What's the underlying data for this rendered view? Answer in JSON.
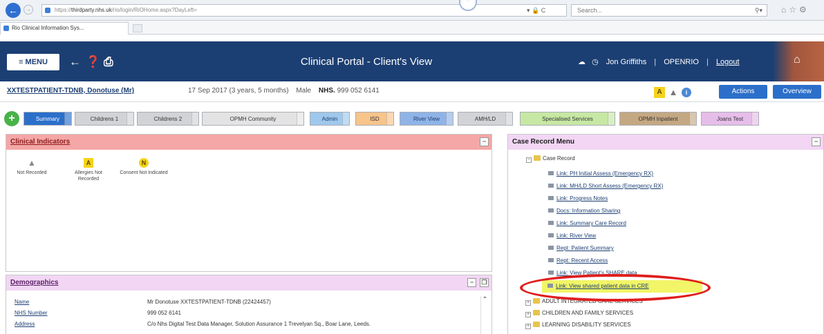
{
  "browser": {
    "url_prefix": "https://",
    "url_domain": "thirdparty.nhs.uk",
    "url_rest": "/rio/login/RiOHome.aspx?DayLeft=",
    "address_tools": "▾ 🔒 C",
    "search_placeholder": "Search...",
    "tab_title": "Rio Clinical Information Sys..."
  },
  "header": {
    "menu_label": "≡ MENU",
    "title": "Clinical Portal - Client's View",
    "user": "Jon Griffiths",
    "role": "OPENRIO",
    "logout": "Logout"
  },
  "patient": {
    "name": "XXTESTPATIENT-TDNB, Donotuse (Mr)",
    "dob_age": "17 Sep 2017 (3 years, 5 months)",
    "sex": "Male",
    "nhs_label": "NHS.",
    "nhs_number": "999 052 6141",
    "actions_label": "Actions",
    "overview_label": "Overview"
  },
  "tabs": [
    {
      "label": "Summary",
      "color": "#2b6fca",
      "text": "#ffffff"
    },
    {
      "label": "Childrens 1",
      "color": "#d2d3d6",
      "text": "#333333"
    },
    {
      "label": "Childrens 2",
      "color": "#d2d3d6",
      "text": "#333333"
    },
    {
      "label": "OPMH Community",
      "color": "#e3e3e3",
      "text": "#333333"
    },
    {
      "label": "Admin",
      "color": "#9fc8ec",
      "text": "#1c3f73"
    },
    {
      "label": "ISD",
      "color": "#f7c48a",
      "text": "#333333"
    },
    {
      "label": "River View",
      "color": "#8fb3e6",
      "text": "#1c3f73"
    },
    {
      "label": "AMH/LD",
      "color": "#d2d3d6",
      "text": "#333333"
    },
    {
      "label": "Specialised Services",
      "color": "#c7e8a4",
      "text": "#333333"
    },
    {
      "label": "OPMH Inpatient",
      "color": "#c4a883",
      "text": "#333333"
    },
    {
      "label": "Joans Test",
      "color": "#e6bde9",
      "text": "#333333"
    }
  ],
  "clinical_indicators": {
    "title": "Clinical Indicators",
    "items": [
      {
        "icon": "warning-icon",
        "label": "Not Recorded",
        "glyph": "▲"
      },
      {
        "icon": "allergies-icon",
        "label": "Allergies Not Recorded",
        "glyph": "A"
      },
      {
        "icon": "consent-icon",
        "label": "Consent Not Indicated",
        "glyph": "N"
      }
    ]
  },
  "demographics": {
    "title": "Demographics",
    "rows": [
      {
        "label": "Name",
        "value": "Mr Donotuse XXTESTPATIENT-TDNB (22424457)"
      },
      {
        "label": "NHS Number",
        "value": "999 052 6141"
      },
      {
        "label": "Address",
        "value": "C/o Nhs Digital Test Data Manager, Solution Assurance 1 Trevelyan Sq., Boar Lane, Leeds."
      }
    ]
  },
  "case_record_menu": {
    "title": "Case Record Menu",
    "root": "Case Record",
    "items": [
      "Link: PH Initial Assess (Emergency RX)",
      "Link: MH/LD Short Assess (Emergency RX)",
      "Link: Progress Notes",
      "Docs: Information Sharing",
      "Link: Summary Care Record",
      "Link: River View",
      "Rept: Patient Summary",
      "Rept: Recent Access",
      "Link: View Patient's SHARE data",
      "Link: View shared patient data in CRE"
    ],
    "folders": [
      "ADULT INTEGRATED CARE SERVICES",
      "CHILDREN AND FAMILY SERVICES",
      "LEARNING DISABILITY SERVICES"
    ]
  },
  "colors": {
    "header_bg": "#1c3f73",
    "highlight": "#eef34c",
    "annotation": "#e01e1e"
  }
}
